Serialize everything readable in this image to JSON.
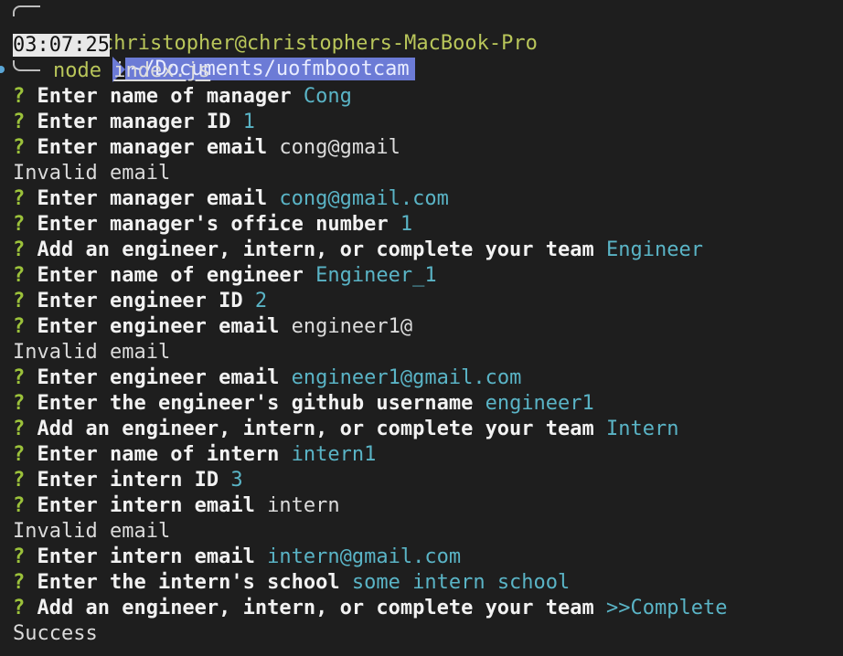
{
  "prompt": {
    "user_host": "christopher@christophers-MacBook-Pro",
    "path": "~/Documents/uofmbootcam",
    "time": "03:07:25",
    "cmd_program": "node",
    "cmd_arg": "index.js"
  },
  "lines": [
    {
      "type": "qa",
      "q": "?",
      "text": "Enter name of manager",
      "answer": "Cong"
    },
    {
      "type": "qa",
      "q": "?",
      "text": "Enter manager ID",
      "answer": "1"
    },
    {
      "type": "qa_plain",
      "q": "?",
      "text": "Enter manager email",
      "answer": "cong@gmail"
    },
    {
      "type": "plain",
      "text": "Invalid email"
    },
    {
      "type": "qa",
      "q": "?",
      "text": "Enter manager email",
      "answer": "cong@gmail.com"
    },
    {
      "type": "qa",
      "q": "?",
      "text": "Enter manager's office number",
      "answer": "1"
    },
    {
      "type": "qa",
      "q": "?",
      "text": "Add an engineer, intern, or complete your team",
      "answer": "Engineer"
    },
    {
      "type": "qa",
      "q": "?",
      "text": "Enter name of engineer",
      "answer": "Engineer_1"
    },
    {
      "type": "qa",
      "q": "?",
      "text": "Enter engineer ID",
      "answer": "2"
    },
    {
      "type": "qa_plain",
      "q": "?",
      "text": "Enter engineer email",
      "answer": "engineer1@"
    },
    {
      "type": "plain",
      "text": "Invalid email"
    },
    {
      "type": "qa",
      "q": "?",
      "text": "Enter engineer email",
      "answer": "engineer1@gmail.com"
    },
    {
      "type": "qa",
      "q": "?",
      "text": "Enter the engineer's github username",
      "answer": "engineer1"
    },
    {
      "type": "qa",
      "q": "?",
      "text": "Add an engineer, intern, or complete your team",
      "answer": "Intern"
    },
    {
      "type": "qa",
      "q": "?",
      "text": "Enter name of intern",
      "answer": "intern1"
    },
    {
      "type": "qa",
      "q": "?",
      "text": "Enter intern ID",
      "answer": "3"
    },
    {
      "type": "qa_plain",
      "q": "?",
      "text": "Enter intern email",
      "answer": "intern"
    },
    {
      "type": "plain",
      "text": "Invalid email"
    },
    {
      "type": "qa",
      "q": "?",
      "text": "Enter intern email",
      "answer": "intern@gmail.com"
    },
    {
      "type": "qa",
      "q": "?",
      "text": "Enter the intern's school",
      "answer": "some intern school"
    },
    {
      "type": "qa",
      "q": "?",
      "text": "Add an engineer, intern, or complete your team",
      "answer": ">>Complete"
    },
    {
      "type": "plain",
      "text": "Success"
    }
  ],
  "colors": {
    "background": "#1e1e1e",
    "question_mark": "#9cc23b",
    "answer": "#5ab4c6",
    "path_bg": "#6c7bd6",
    "user": "#b9c65a"
  }
}
